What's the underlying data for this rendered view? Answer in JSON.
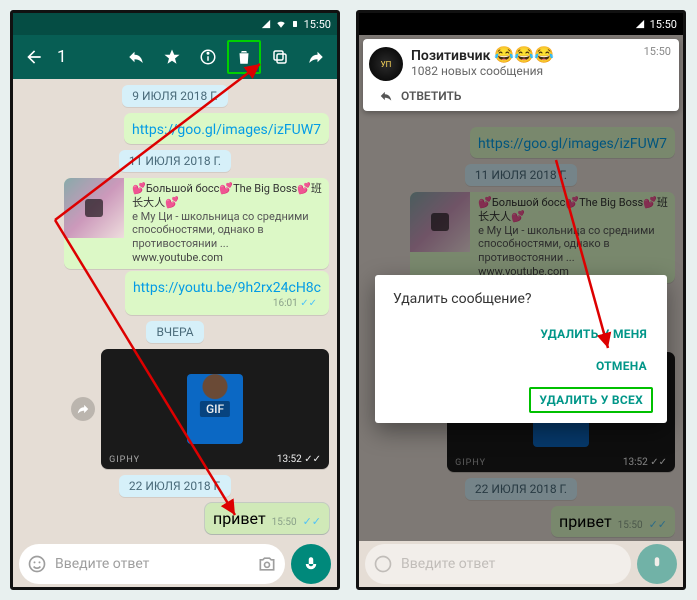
{
  "status": {
    "time": "15:50"
  },
  "toolbar": {
    "count": "1"
  },
  "dates": {
    "d1": "9 ИЮЛЯ 2018 Г.",
    "d2": "11 ИЮЛЯ 2018 Г.",
    "d3": "ВЧЕРА",
    "d4": "22 ИЮЛЯ 2018 Г."
  },
  "links": {
    "link1": "https://goo.gl/images/izFUW7",
    "link2": "https://youtu.be/9h2rx24cH8c"
  },
  "youtube": {
    "title": "💕Большой босс💕The Big Boss💕班长大人💕",
    "desc": "е Му Ци - школьница со средними способностями, однако в противостоянии ...",
    "domain": "www.youtube.com",
    "time": "16:01"
  },
  "gif": {
    "label": "GIF",
    "giphy": "GIPHY",
    "time": "13:52"
  },
  "msg_hello": {
    "text": "привет",
    "time": "15:50"
  },
  "input": {
    "placeholder": "Введите ответ"
  },
  "notif": {
    "title": "Позитивчик",
    "emoji": "😂😂😂",
    "sub": "1082 новых сообщения",
    "time": "15:50",
    "reply": "ОТВЕТИТЬ"
  },
  "dialog": {
    "title": "Удалить сообщение?",
    "del_me": "УДАЛИТЬ У МЕНЯ",
    "cancel": "ОТМЕНА",
    "del_all": "УДАЛИТЬ У ВСЕХ"
  }
}
